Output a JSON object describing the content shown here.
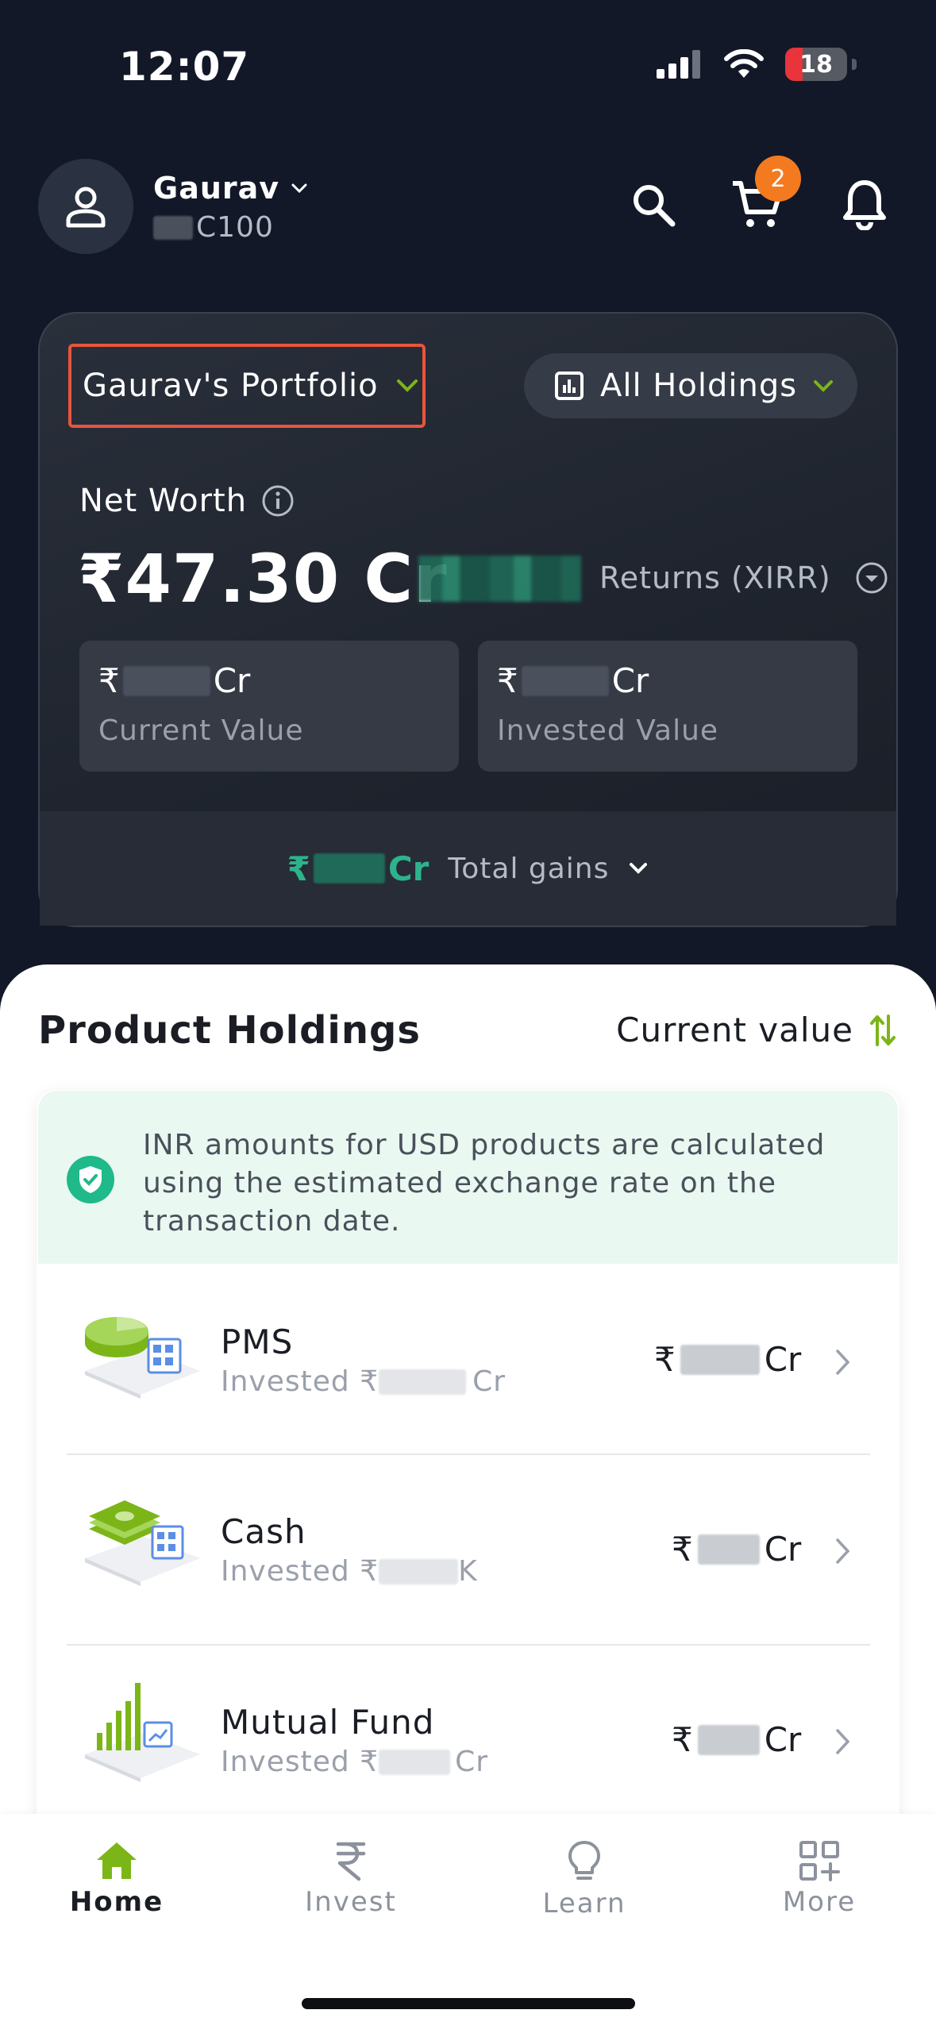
{
  "status_bar": {
    "time": "12:07",
    "battery": "18"
  },
  "header": {
    "user_name": "Gaurav",
    "user_id_suffix": "C100",
    "cart_count": "2"
  },
  "portfolio": {
    "selector_label": "Gaurav's Portfolio",
    "holdings_filter": "All Holdings",
    "net_worth_label": "Net Worth",
    "net_worth_value": "₹47.30 Cr",
    "returns_label": "Returns (XIRR)",
    "current_value": {
      "prefix": "₹",
      "suffix": "Cr",
      "label": "Current Value"
    },
    "invested_value": {
      "prefix": "₹",
      "suffix": "Cr",
      "label": "Invested Value"
    },
    "gains": {
      "prefix": "₹",
      "suffix": "Cr",
      "label": "Total gains"
    }
  },
  "holdings": {
    "title": "Product Holdings",
    "sort_label": "Current value",
    "info_text": "INR amounts for USD products are calculated using the estimated exchange rate on the transaction date.",
    "items": [
      {
        "name": "PMS",
        "invested_prefix": "Invested ₹",
        "invested_suffix": "Cr",
        "value_prefix": "₹",
        "value_suffix": "Cr"
      },
      {
        "name": "Cash",
        "invested_prefix": "Invested ₹",
        "invested_suffix": "K",
        "value_prefix": "₹",
        "value_suffix": "Cr"
      },
      {
        "name": "Mutual Fund",
        "invested_prefix": "Invested ₹",
        "invested_suffix": "Cr",
        "value_prefix": "₹",
        "value_suffix": "Cr"
      }
    ]
  },
  "bottom_nav": {
    "items": [
      {
        "label": "Home",
        "icon": "home-icon",
        "active": true
      },
      {
        "label": "Invest",
        "icon": "rupee-icon",
        "active": false
      },
      {
        "label": "Learn",
        "icon": "lightbulb-icon",
        "active": false
      },
      {
        "label": "More",
        "icon": "grid-plus-icon",
        "active": false
      }
    ]
  },
  "colors": {
    "background": "#121827",
    "accent_green": "#7cb518",
    "gain_green": "#2db38c",
    "badge_orange": "#f47a1f",
    "highlight_border": "#e8553c"
  }
}
